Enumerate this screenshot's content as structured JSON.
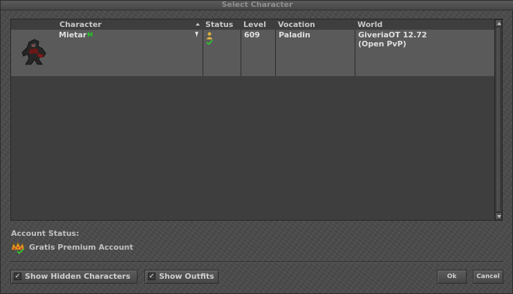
{
  "window": {
    "title": "Select Character"
  },
  "table": {
    "columns": [
      "Character",
      "Status",
      "Level",
      "Vocation",
      "World"
    ],
    "rows": [
      {
        "name": "Mietar",
        "name_mark": "M",
        "level": "609",
        "vocation": "Paladin",
        "world_line1": "GiveriaOT 12.72",
        "world_line2": "(Open PvP)"
      }
    ]
  },
  "account": {
    "label": "Account Status:",
    "status": "Gratis Premium Account"
  },
  "options": {
    "show_hidden": {
      "label": "Show Hidden Characters",
      "checked": true,
      "mark": "✓"
    },
    "show_outfits": {
      "label": "Show Outfits",
      "checked": true,
      "mark": "✓"
    }
  },
  "buttons": {
    "ok": "Ok",
    "cancel": "Cancel"
  },
  "colors": {
    "row_selected": "#5a5a5a",
    "list_bg": "#3e3e3e",
    "window_bg": "#4b4b4b",
    "mark_green": "#20d020"
  },
  "icons": [
    "sort-ascending-icon",
    "pin-icon",
    "character-outfit-icon",
    "status-online-icon",
    "premium-crown-icon",
    "checkmark-icon"
  ]
}
